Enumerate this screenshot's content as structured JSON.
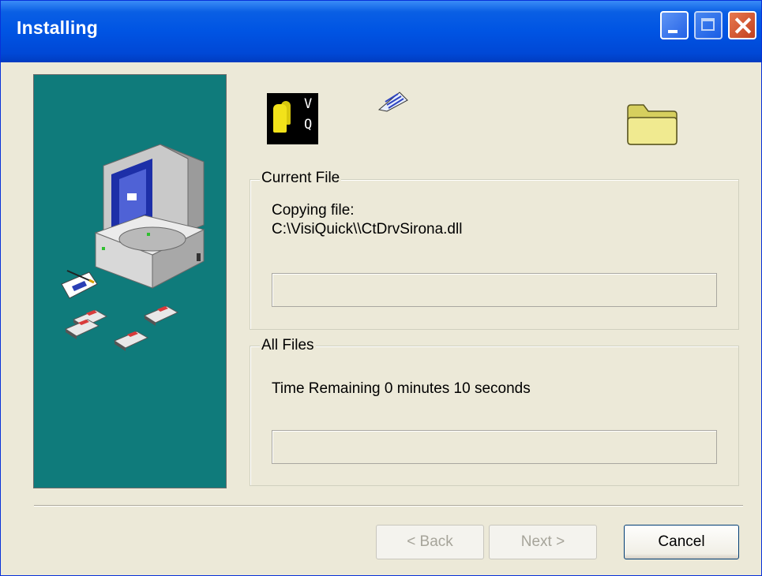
{
  "window": {
    "title": "Installing"
  },
  "current_file": {
    "legend": "Current File",
    "status_line": "Copying file:",
    "file_path": "C:\\VisiQuick\\\\CtDrvSirona.dll",
    "progress": 0
  },
  "all_files": {
    "legend": "All Files",
    "time_remaining": "Time Remaining 0 minutes 10 seconds",
    "progress": 0
  },
  "app_icon": {
    "letter_top": "V",
    "letter_bottom": "Q"
  },
  "buttons": {
    "back": "< Back",
    "next": "Next >",
    "cancel": "Cancel"
  },
  "colors": {
    "titlebar": "#0054e3",
    "side_panel": "#0f7b7b",
    "dialog_bg": "#ece9d8"
  },
  "icons": [
    "minimize-icon",
    "maximize-icon",
    "close-icon",
    "app-icon",
    "paper-icon",
    "folder-icon",
    "computer-illustration"
  ]
}
